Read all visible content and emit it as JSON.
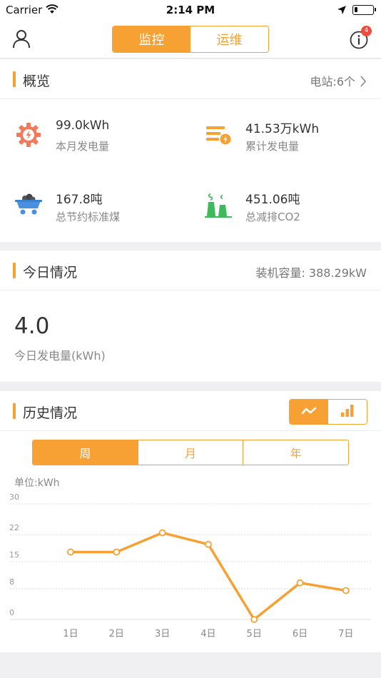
{
  "status": {
    "carrier": "Carrier",
    "time": "2:14 PM"
  },
  "nav": {
    "tabs": [
      {
        "label": "监控",
        "active": true
      },
      {
        "label": "运维",
        "active": false
      }
    ],
    "badge_count": "4"
  },
  "overview": {
    "title": "概览",
    "stations": "电站:6个",
    "items": [
      {
        "value": "99.0kWh",
        "label": "本月发电量",
        "icon": "gear-bolt-icon"
      },
      {
        "value": "41.53万kWh",
        "label": "累计发电量",
        "icon": "stacked-bars-bolt-icon"
      },
      {
        "value": "167.8吨",
        "label": "总节约标准煤",
        "icon": "coal-cart-icon"
      },
      {
        "value": "451.06吨",
        "label": "总减排CO2",
        "icon": "factory-chimney-icon"
      }
    ]
  },
  "today": {
    "title": "今日情况",
    "capacity": "装机容量: 388.29kW",
    "value": "4.0",
    "label": "今日发电量(kWh)"
  },
  "history": {
    "title": "历史情况",
    "chart_toggle": [
      {
        "icon": "line-chart-icon",
        "active": true
      },
      {
        "icon": "bar-chart-icon",
        "active": false
      }
    ],
    "periods": [
      {
        "label": "周",
        "active": true
      },
      {
        "label": "月",
        "active": false
      },
      {
        "label": "年",
        "active": false
      }
    ],
    "unit": "单位:kWh"
  },
  "colors": {
    "accent": "#f7a033",
    "icon_red": "#f07a5a",
    "icon_blue": "#4a8fe0",
    "icon_green": "#3dbb5a",
    "badge": "#f24b3c"
  },
  "chart_data": {
    "type": "line",
    "categories": [
      "1日",
      "2日",
      "3日",
      "4日",
      "5日",
      "6日",
      "7日"
    ],
    "values": [
      17.5,
      17.5,
      22.5,
      19.5,
      0,
      9.5,
      7.5
    ],
    "y_ticks": [
      "30",
      "22",
      "15",
      "8",
      "0"
    ],
    "ylim": [
      0,
      30
    ],
    "grid": true,
    "legend": "none"
  }
}
